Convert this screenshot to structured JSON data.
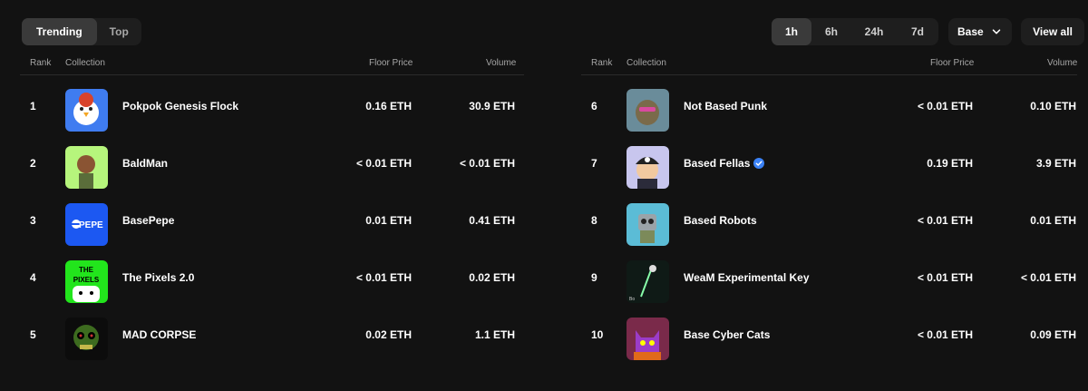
{
  "tabs": [
    {
      "label": "Trending",
      "active": true
    },
    {
      "label": "Top",
      "active": false
    }
  ],
  "timeframes": [
    {
      "label": "1h",
      "active": true
    },
    {
      "label": "6h",
      "active": false
    },
    {
      "label": "24h",
      "active": false
    },
    {
      "label": "7d",
      "active": false
    }
  ],
  "chain_select": {
    "label": "Base",
    "icon": "chevron-down-icon"
  },
  "view_all_label": "View all",
  "columns": {
    "rank": "Rank",
    "collection": "Collection",
    "floor": "Floor Price",
    "volume": "Volume"
  },
  "collections": [
    {
      "rank": "1",
      "name": "Pokpok Genesis Flock",
      "floor": "0.16 ETH",
      "volume": "30.9 ETH",
      "verified": false,
      "thumb_bg": "#3f7cf0"
    },
    {
      "rank": "2",
      "name": "BaldMan",
      "floor": "< 0.01 ETH",
      "volume": "< 0.01 ETH",
      "verified": false,
      "thumb_bg": "#b6f57c"
    },
    {
      "rank": "3",
      "name": "BasePepe",
      "floor": "0.01 ETH",
      "volume": "0.41 ETH",
      "verified": false,
      "thumb_bg": "#1c58f2",
      "thumb_text": "PEPE"
    },
    {
      "rank": "4",
      "name": "The Pixels 2.0",
      "floor": "< 0.01 ETH",
      "volume": "0.02 ETH",
      "verified": false,
      "thumb_bg": "#22e51c",
      "thumb_text": "THE PIXELS"
    },
    {
      "rank": "5",
      "name": "MAD CORPSE",
      "floor": "0.02 ETH",
      "volume": "1.1 ETH",
      "verified": false,
      "thumb_bg": "#0c0c0c"
    },
    {
      "rank": "6",
      "name": "Not Based Punk",
      "floor": "< 0.01 ETH",
      "volume": "0.10 ETH",
      "verified": false,
      "thumb_bg": "#6a8c9a"
    },
    {
      "rank": "7",
      "name": "Based Fellas",
      "floor": "0.19 ETH",
      "volume": "3.9 ETH",
      "verified": true,
      "thumb_bg": "#c8c6ee"
    },
    {
      "rank": "8",
      "name": "Based Robots",
      "floor": "< 0.01 ETH",
      "volume": "0.01 ETH",
      "verified": false,
      "thumb_bg": "#5bbcd6"
    },
    {
      "rank": "9",
      "name": "WeaM Experimental Key",
      "floor": "< 0.01 ETH",
      "volume": "< 0.01 ETH",
      "verified": false,
      "thumb_bg": "#0f1a16",
      "thumb_text": "Bo"
    },
    {
      "rank": "10",
      "name": "Base Cyber Cats",
      "floor": "< 0.01 ETH",
      "volume": "0.09 ETH",
      "verified": false,
      "thumb_bg": "#7a2a4a"
    }
  ],
  "colors": {
    "background": "#121212",
    "surface": "#1e1e1e",
    "active": "#3a3a3a",
    "verified_badge": "#3b82f6"
  }
}
